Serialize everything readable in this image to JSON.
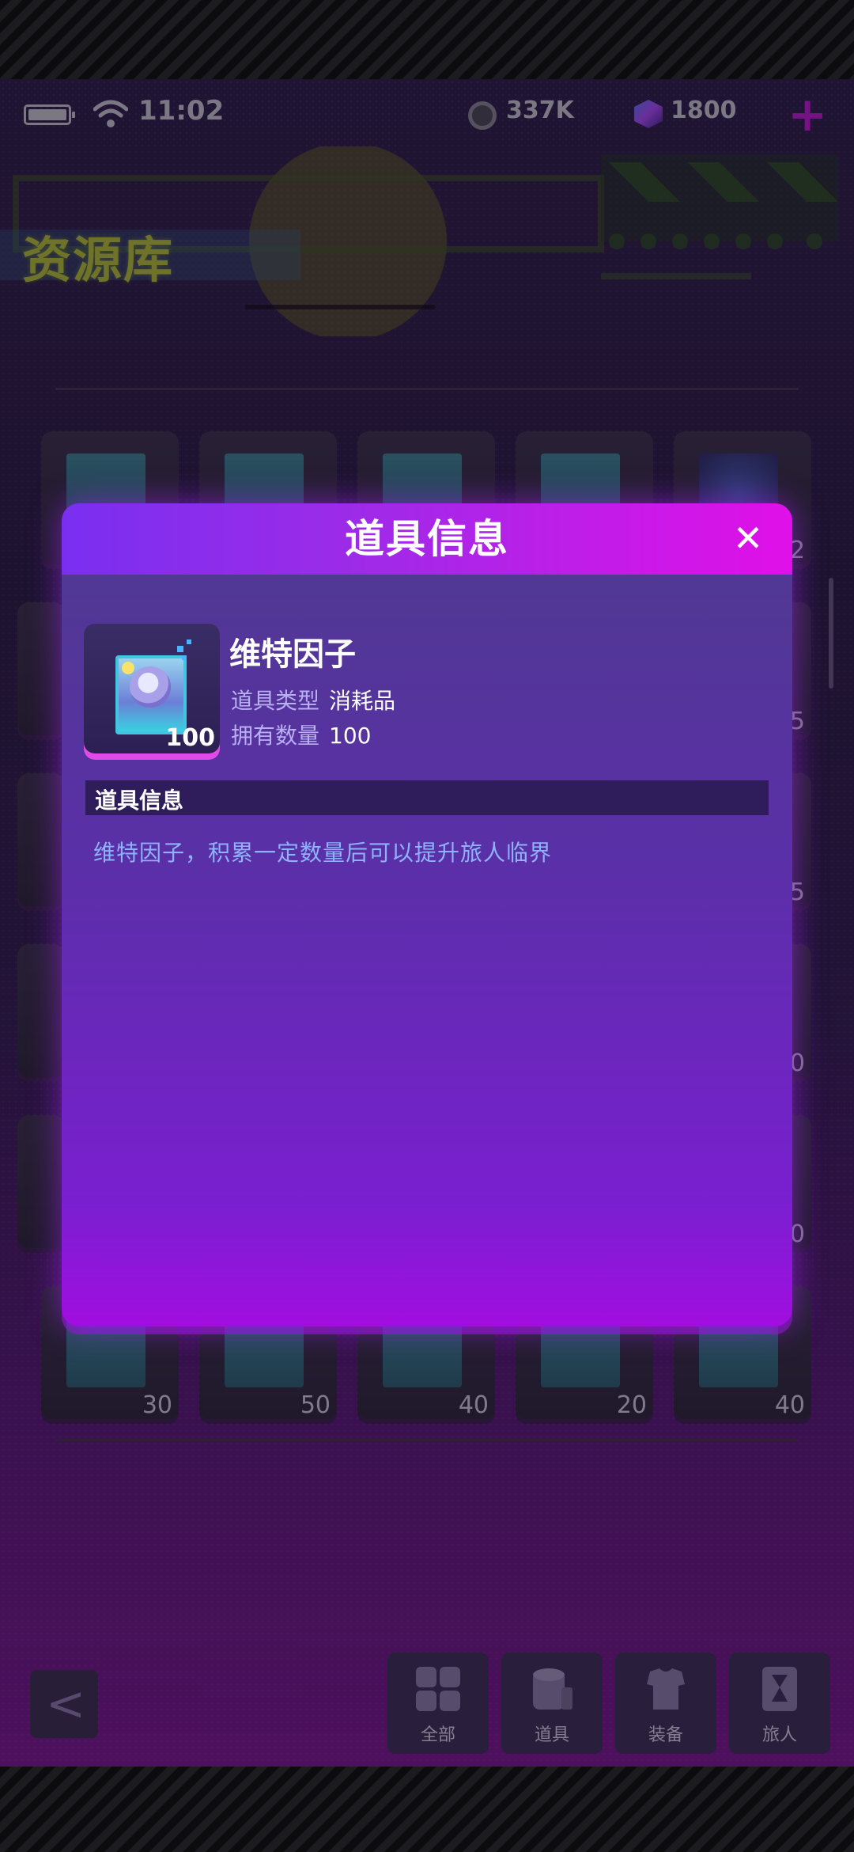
{
  "status": {
    "time": "11:02",
    "coins": "337K",
    "gems": "1800",
    "plus": "+"
  },
  "header": {
    "title": "资源库"
  },
  "grid_counts": [
    "",
    "",
    "",
    "",
    "2",
    "5",
    "5",
    "0",
    "0",
    "30",
    "50",
    "40",
    "20",
    "40"
  ],
  "nav": {
    "back": "<",
    "tabs": [
      {
        "label": "全部"
      },
      {
        "label": "道具"
      },
      {
        "label": "装备"
      },
      {
        "label": "旅人"
      }
    ]
  },
  "modal": {
    "title": "道具信息",
    "close": "✕",
    "item": {
      "name": "维特因子",
      "count": "100",
      "type_label": "道具类型",
      "type_value": "消耗品",
      "qty_label": "拥有数量",
      "qty_value": "100"
    },
    "section_title": "道具信息",
    "description": "维特因子，积累一定数量后可以提升旅人临界"
  }
}
